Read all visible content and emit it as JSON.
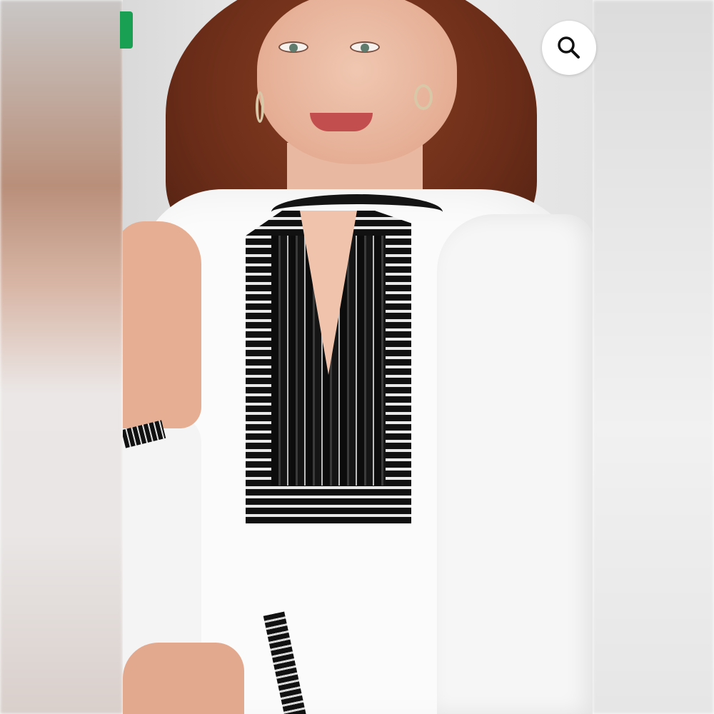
{
  "viewer": {
    "search_button": {
      "icon": "search-icon"
    },
    "badge": {
      "color": "#1aa053"
    }
  }
}
